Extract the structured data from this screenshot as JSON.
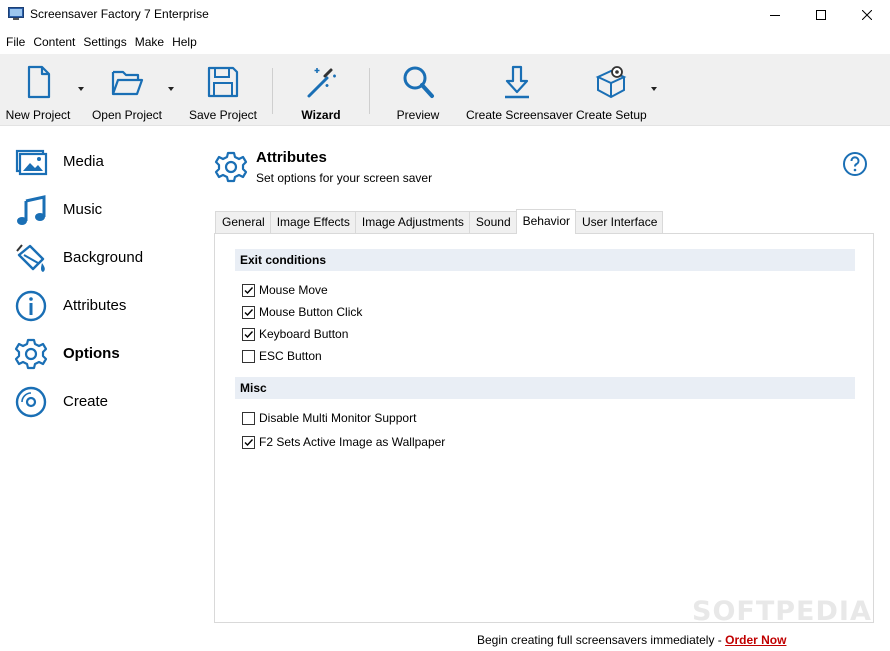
{
  "window": {
    "title": "Screensaver Factory 7 Enterprise"
  },
  "menu": [
    "File",
    "Content",
    "Settings",
    "Make",
    "Help"
  ],
  "toolbar": {
    "new_project": "New Project",
    "open_project": "Open Project",
    "save_project": "Save Project",
    "wizard": "Wizard",
    "preview": "Preview",
    "create_screensaver": "Create Screensaver",
    "create_setup": "Create Setup"
  },
  "sidebar": {
    "items": [
      {
        "label": "Media",
        "icon": "media-icon"
      },
      {
        "label": "Music",
        "icon": "music-icon"
      },
      {
        "label": "Background",
        "icon": "paint-bucket-icon"
      },
      {
        "label": "Attributes",
        "icon": "info-icon"
      },
      {
        "label": "Options",
        "icon": "gear-icon",
        "active": true
      },
      {
        "label": "Create",
        "icon": "disc-icon"
      }
    ]
  },
  "header": {
    "title": "Attributes",
    "subtitle": "Set options for your screen saver"
  },
  "tabs": [
    "General",
    "Image Effects",
    "Image Adjustments",
    "Sound",
    "Behavior",
    "User Interface"
  ],
  "active_tab": "Behavior",
  "behavior": {
    "exit_conditions": {
      "title": "Exit conditions",
      "options": [
        {
          "label": "Mouse Move",
          "checked": true
        },
        {
          "label": "Mouse Button Click",
          "checked": true
        },
        {
          "label": "Keyboard Button",
          "checked": true
        },
        {
          "label": "ESC Button",
          "checked": false
        }
      ]
    },
    "misc": {
      "title": "Misc",
      "options": [
        {
          "label": "Disable Multi Monitor Support",
          "checked": false
        },
        {
          "label": "F2 Sets Active Image as Wallpaper",
          "checked": true
        }
      ]
    }
  },
  "footer": {
    "text": "Begin creating full screensavers immediately - ",
    "link": "Order Now"
  },
  "watermark": "SOFTPEDIA",
  "colors": {
    "accent": "#1a6fb5",
    "link": "#c00000",
    "section_bg": "#e9eef5",
    "toolbar_bg": "#f0f0f0"
  }
}
